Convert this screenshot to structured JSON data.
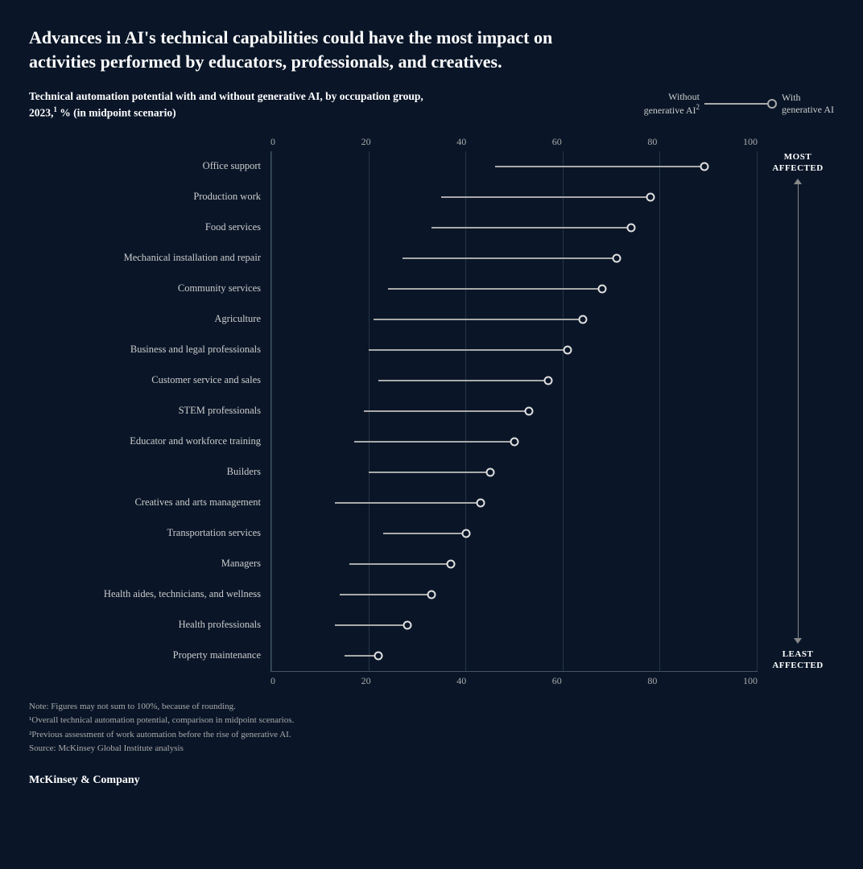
{
  "title": "Advances in AI's technical capabilities could have the most impact on activities performed by educators, professionals, and creatives.",
  "subtitle": "Technical automation potential with and without generative AI, by occupation group, 2023,",
  "subtitle_footnote": "1",
  "subtitle_suffix": " % (in midpoint scenario)",
  "legend": {
    "without_label": "Without\ngenerative AI",
    "without_footnote": "2",
    "with_label": "With\ngenerative AI"
  },
  "x_axis_labels": [
    "0",
    "20",
    "40",
    "60",
    "80",
    "100"
  ],
  "most_affected_label": "MOST\nAFFECTED",
  "least_affected_label": "LEAST\nAFFECTED",
  "occupations": [
    {
      "label": "Office support",
      "without": 46,
      "with": 89
    },
    {
      "label": "Production work",
      "without": 35,
      "with": 78
    },
    {
      "label": "Food services",
      "without": 33,
      "with": 74
    },
    {
      "label": "Mechanical installation and repair",
      "without": 27,
      "with": 71
    },
    {
      "label": "Community services",
      "without": 24,
      "with": 68
    },
    {
      "label": "Agriculture",
      "without": 21,
      "with": 64
    },
    {
      "label": "Business and legal professionals",
      "without": 20,
      "with": 61
    },
    {
      "label": "Customer service and sales",
      "without": 22,
      "with": 57
    },
    {
      "label": "STEM professionals",
      "without": 19,
      "with": 53
    },
    {
      "label": "Educator and workforce training",
      "without": 17,
      "with": 50
    },
    {
      "label": "Builders",
      "without": 20,
      "with": 45
    },
    {
      "label": "Creatives and arts management",
      "without": 13,
      "with": 43
    },
    {
      "label": "Transportation services",
      "without": 23,
      "with": 40
    },
    {
      "label": "Managers",
      "without": 16,
      "with": 37
    },
    {
      "label": "Health aides, technicians, and wellness",
      "without": 14,
      "with": 33
    },
    {
      "label": "Health professionals",
      "without": 13,
      "with": 28
    },
    {
      "label": "Property maintenance",
      "without": 15,
      "with": 22
    }
  ],
  "notes": [
    "Note: Figures may not sum to 100%, because of rounding.",
    "¹Overall technical automation potential, comparison in midpoint scenarios.",
    "²Previous assessment of work automation before the rise of generative AI.",
    "Source: McKinsey Global Institute analysis"
  ],
  "brand": "McKinsey & Company"
}
